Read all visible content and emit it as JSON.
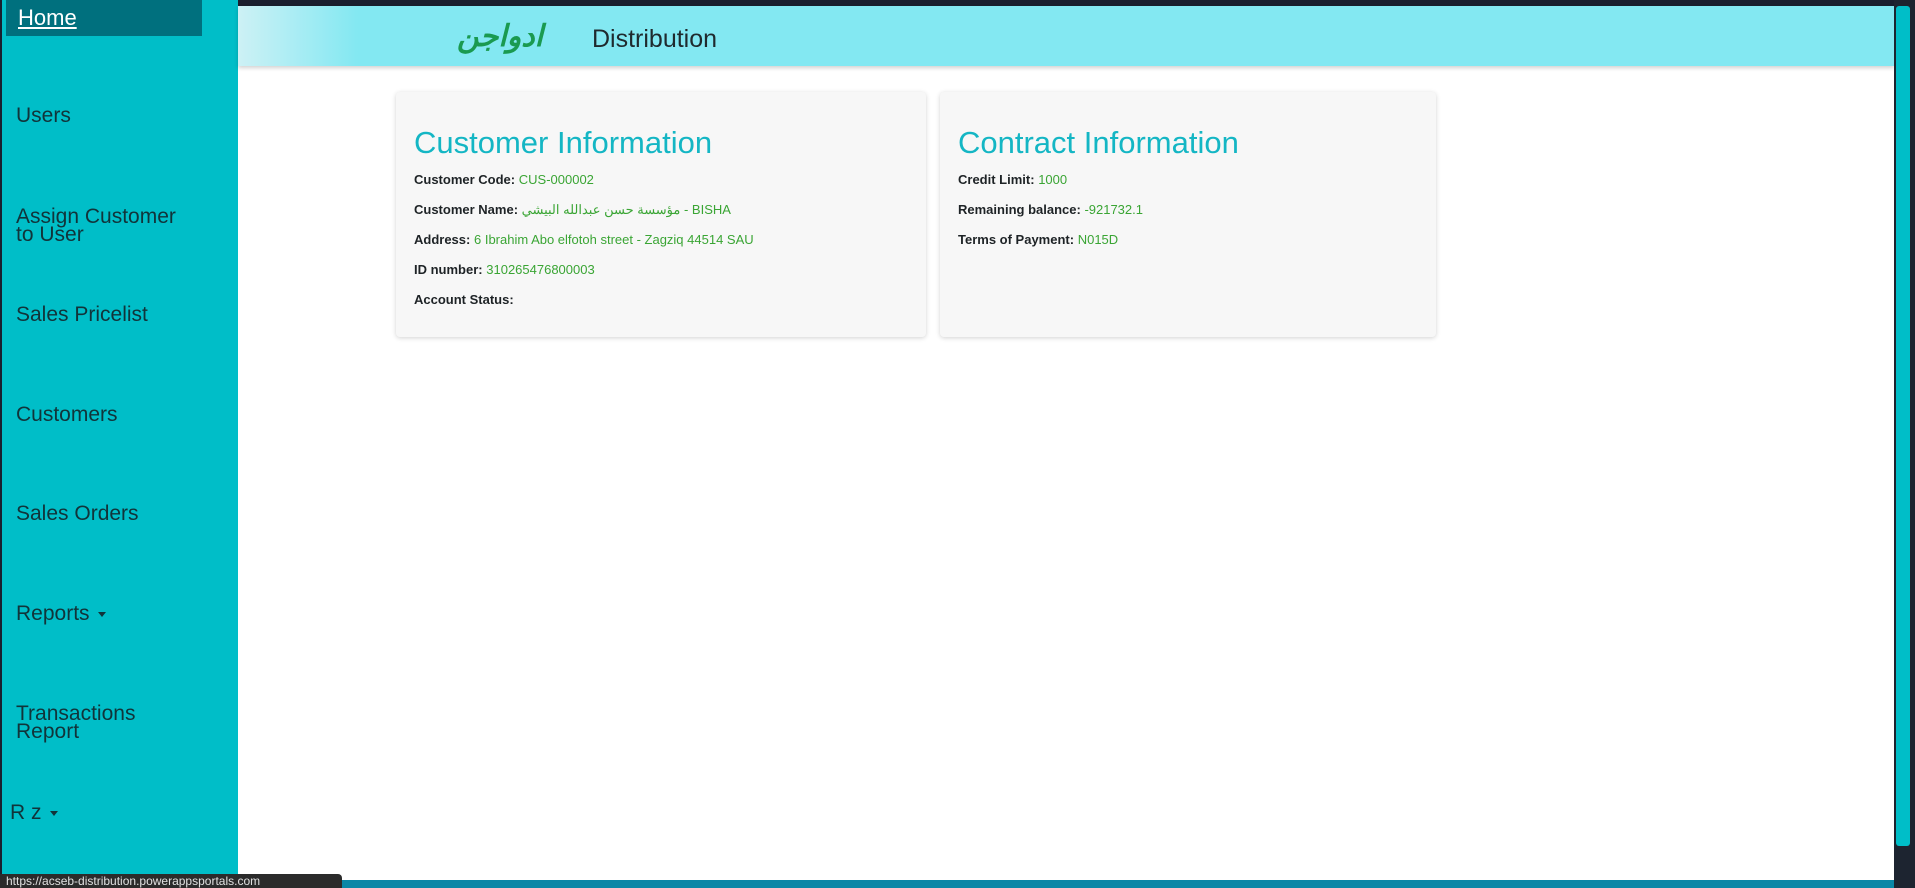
{
  "nav": {
    "home": "Home",
    "users": "Users",
    "assign_line1": "Assign Customer",
    "assign_line2": "to User",
    "sales_pricelist": "Sales Pricelist",
    "customers": "Customers",
    "sales_orders": "Sales Orders",
    "reports": "Reports",
    "transactions_line1": "Transactions",
    "transactions_line2": "Report",
    "user": "R z"
  },
  "header": {
    "logo_text": "ادواجن",
    "title": "Distribution"
  },
  "customer_info": {
    "heading": "Customer Information",
    "code_label": "Customer Code:",
    "code_value": "CUS-000002",
    "name_label": "Customer Name:",
    "name_value": "مؤسسة حسن عبدالله البيشي - BISHA",
    "address_label": "Address:",
    "address_value": "6 Ibrahim Abo elfotoh street - Zagziq 44514 SAU",
    "id_label": "ID number:",
    "id_value": "310265476800003",
    "status_label": "Account Status:",
    "status_value": ""
  },
  "contract_info": {
    "heading": "Contract Information",
    "credit_label": "Credit Limit:",
    "credit_value": "1000",
    "balance_label": "Remaining balance:",
    "balance_value": "-921732.1",
    "terms_label": "Terms of Payment:",
    "terms_value": "N015D"
  },
  "status_bar": {
    "url": "https://acseb-distribution.powerappsportals.com"
  },
  "colors": {
    "sidebar": "#00bec8",
    "active_nav": "#00707e",
    "header": "#83e8f2",
    "heading": "#14b6c4",
    "value": "#3aa534",
    "logo": "#1a9a50"
  }
}
